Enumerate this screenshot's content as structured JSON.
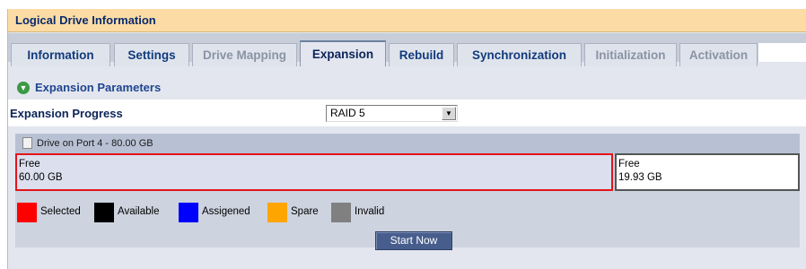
{
  "title": "Logical Drive Information",
  "tabs": [
    {
      "label": "Information",
      "state": "normal"
    },
    {
      "label": "Settings",
      "state": "normal"
    },
    {
      "label": "Drive Mapping",
      "state": "disabled"
    },
    {
      "label": "Expansion",
      "state": "active"
    },
    {
      "label": "Rebuild",
      "state": "normal"
    },
    {
      "label": "Synchronization",
      "state": "normal"
    },
    {
      "label": "Initialization",
      "state": "disabled"
    },
    {
      "label": "Activation",
      "state": "disabled"
    }
  ],
  "section": {
    "title": "Expansion Parameters",
    "icon": "chevron-down-circle-icon"
  },
  "expansion": {
    "progress_label": "Expansion Progress",
    "raid_select": {
      "value": "RAID 5"
    }
  },
  "drive": {
    "header": "Drive on Port 4 - 80.00 GB",
    "segments": [
      {
        "line1": "Free",
        "line2": "60.00 GB",
        "status": "Selected"
      },
      {
        "line1": "Free",
        "line2": "19.93 GB",
        "status": "Available"
      }
    ]
  },
  "legend": [
    {
      "label": "Selected",
      "color": "#ff0000"
    },
    {
      "label": "Available",
      "color": "#000000"
    },
    {
      "label": "Assigened",
      "color": "#0000ff"
    },
    {
      "label": "Spare",
      "color": "#ffa500"
    },
    {
      "label": "Invalid",
      "color": "#808080"
    }
  ],
  "actions": {
    "start_label": "Start Now"
  },
  "colors": {
    "title_bg": "#fcdca4",
    "accent_red": "#e4141c",
    "button_bg": "#475e8d"
  }
}
